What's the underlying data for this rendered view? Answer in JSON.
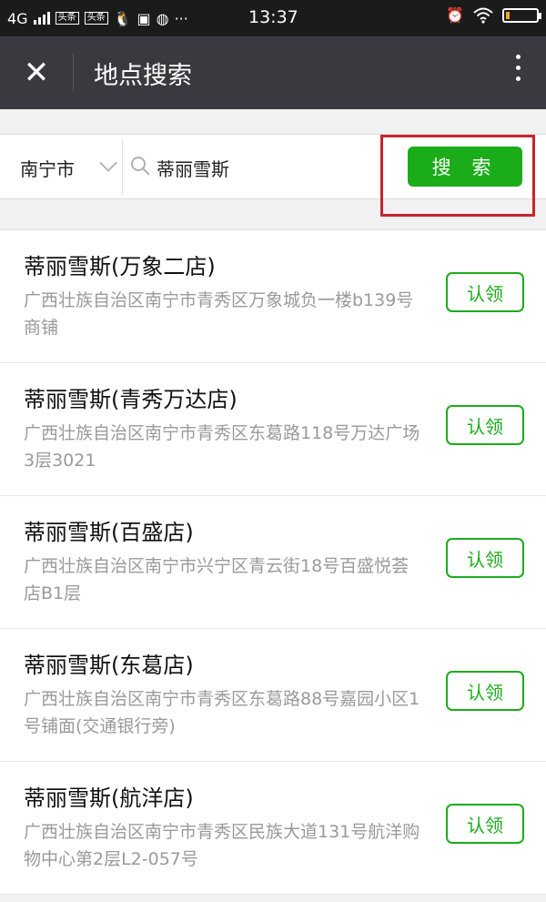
{
  "status_bar": {
    "network": "4G",
    "badge1": "头条",
    "badge2": "头条",
    "ellipsis": "···",
    "time": "13:37"
  },
  "title_bar": {
    "close_icon": "✕",
    "title": "地点搜索"
  },
  "search": {
    "city": "南宁市",
    "query": "蒂丽雪斯",
    "button_label": "搜 索"
  },
  "results": [
    {
      "name": "蒂丽雪斯(万象二店)",
      "address": "广西壮族自治区南宁市青秀区万象城负一楼b139号商铺",
      "action": "认领"
    },
    {
      "name": "蒂丽雪斯(青秀万达店)",
      "address": "广西壮族自治区南宁市青秀区东葛路118号万达广场3层3021",
      "action": "认领"
    },
    {
      "name": "蒂丽雪斯(百盛店)",
      "address": "广西壮族自治区南宁市兴宁区青云街18号百盛悦荟店B1层",
      "action": "认领"
    },
    {
      "name": "蒂丽雪斯(东葛店)",
      "address": "广西壮族自治区南宁市青秀区东葛路88号嘉园小区1号铺面(交通银行旁)",
      "action": "认领"
    },
    {
      "name": "蒂丽雪斯(航洋店)",
      "address": "广西壮族自治区南宁市青秀区民族大道131号航洋购物中心第2层L2-057号",
      "action": "认领"
    }
  ],
  "colors": {
    "accent": "#1aad19",
    "title_bar": "#393a3f",
    "highlight": "#c9232d"
  }
}
